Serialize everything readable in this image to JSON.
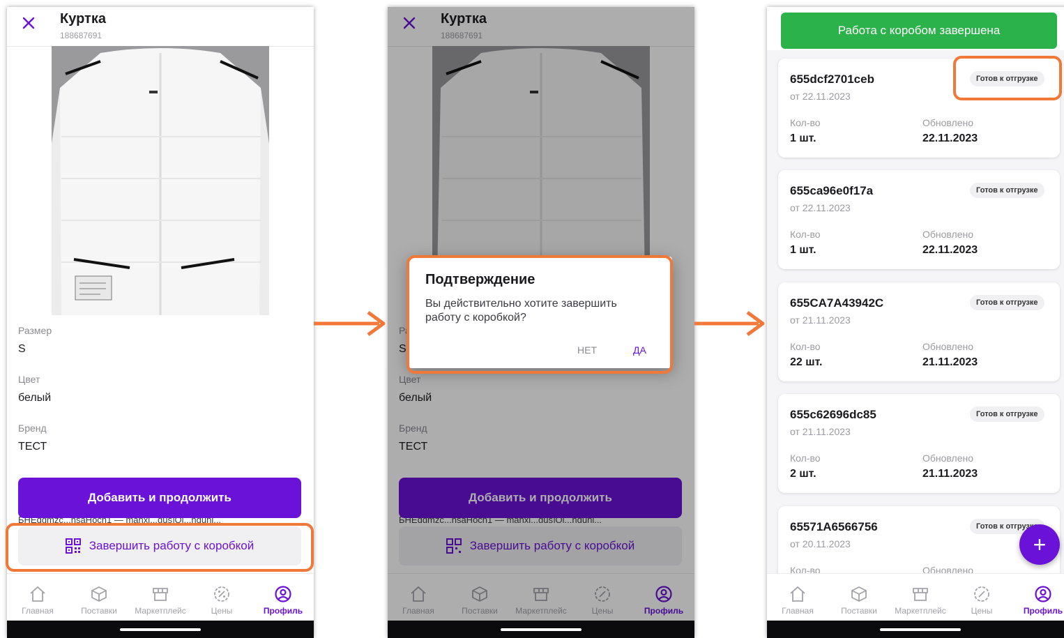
{
  "product": {
    "title": "Куртка",
    "id": "188687691",
    "attributes": [
      {
        "label": "Размер",
        "value": "S"
      },
      {
        "label": "Цвет",
        "value": "белый"
      },
      {
        "label": "Бренд",
        "value": "ТЕСТ"
      }
    ],
    "add_continue_label": "Добавить и продолжить",
    "finish_box_label": "Завершить работу с коробкой",
    "partial_text": "БНЕqgmzc...nsaHoch1 — manxi...gus]Qi...nqunj..."
  },
  "nav": [
    {
      "label": "Главная",
      "icon": "home-icon"
    },
    {
      "label": "Поставки",
      "icon": "box-icon"
    },
    {
      "label": "Маркетплейс",
      "icon": "store-icon"
    },
    {
      "label": "Цены",
      "icon": "percent-badge-icon"
    },
    {
      "label": "Профиль",
      "icon": "profile-icon"
    }
  ],
  "dialog": {
    "title": "Подтверждение",
    "text": "Вы действительно хотите завершить работу с коробкой?",
    "no_label": "НЕТ",
    "yes_label": "ДА"
  },
  "boxes_screen": {
    "done_banner": "Работа с коробом завершена",
    "qty_label": "Кол-во",
    "updated_label": "Обновлено",
    "items": [
      {
        "id": "655dcf2701ceb",
        "date": "от 22.11.2023",
        "status": "Готов к отгрузке",
        "qty": "1 шт.",
        "updated": "22.11.2023"
      },
      {
        "id": "655ca96e0f17a",
        "date": "от 22.11.2023",
        "status": "Готов к отгрузке",
        "qty": "1 шт.",
        "updated": "22.11.2023"
      },
      {
        "id": "655CA7A43942C",
        "date": "от 21.11.2023",
        "status": "Готов к отгрузке",
        "qty": "22 шт.",
        "updated": "21.11.2023"
      },
      {
        "id": "655c62696dc85",
        "date": "от 21.11.2023",
        "status": "Готов к отгрузке",
        "qty": "2 шт.",
        "updated": "21.11.2023"
      },
      {
        "id": "65571A6566756",
        "date": "от 20.11.2023",
        "status": "Готов к отгрузке",
        "qty": "",
        "updated": ""
      }
    ],
    "fab_symbol": "+"
  },
  "colors": {
    "accent": "#6b12d8",
    "success": "#2bb24a",
    "highlight": "#f07838"
  }
}
